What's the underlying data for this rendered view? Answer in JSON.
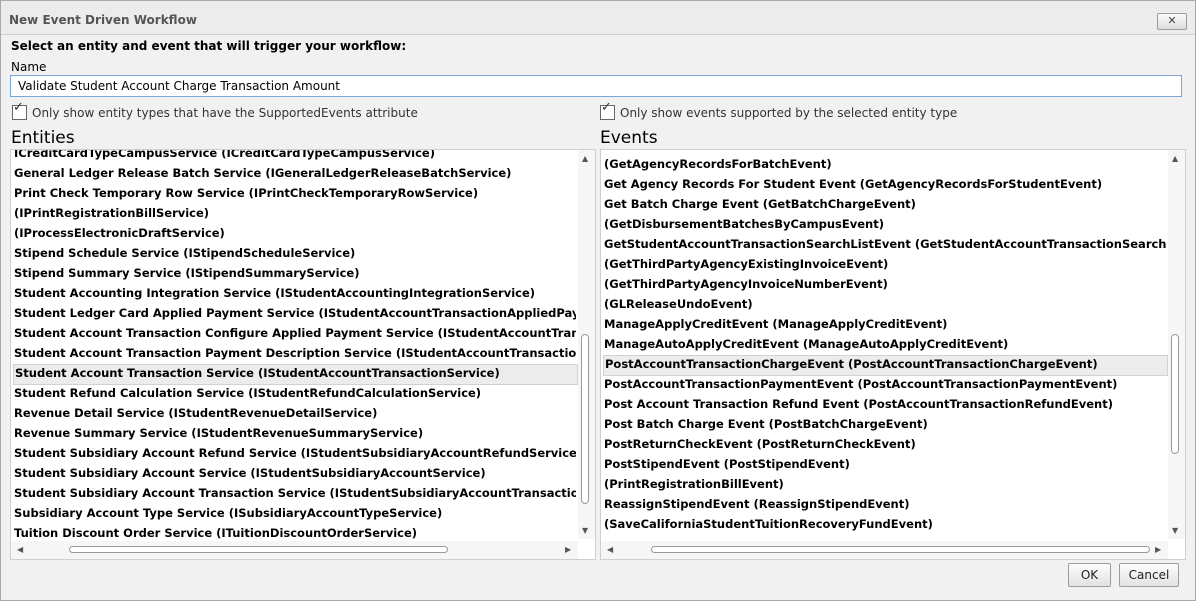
{
  "window": {
    "title": "New Event Driven Workflow",
    "close_glyph": "✕"
  },
  "instruction": "Select an entity and event that will trigger your workflow:",
  "name_field": {
    "label": "Name",
    "value": "Validate Student Account Charge Transaction Amount"
  },
  "entity_filter": {
    "label": "Only show entity types that have the SupportedEvents attribute",
    "checked": true
  },
  "event_filter": {
    "label": "Only show events supported by the selected entity type",
    "checked": true
  },
  "entities": {
    "title": "Entities",
    "selected_index": 11,
    "items": [
      "ICreditCardTypeCampusService (ICreditCardTypeCampusService)",
      "General Ledger Release Batch Service (IGeneralLedgerReleaseBatchService)",
      "Print Check Temporary Row Service (IPrintCheckTemporaryRowService)",
      " (IPrintRegistrationBillService)",
      " (IProcessElectronicDraftService)",
      "Stipend Schedule Service (IStipendScheduleService)",
      "Stipend Summary Service (IStipendSummaryService)",
      "Student Accounting Integration Service (IStudentAccountingIntegrationService)",
      "Student Ledger Card Applied Payment Service (IStudentAccountTransactionAppliedPaymentService)",
      "Student Account Transaction Configure Applied Payment Service (IStudentAccountTransactionConfi",
      "Student Account Transaction Payment Description Service (IStudentAccountTransactionPaymentDes",
      "Student Account Transaction Service (IStudentAccountTransactionService)",
      "Student Refund Calculation Service (IStudentRefundCalculationService)",
      "Revenue Detail Service (IStudentRevenueDetailService)",
      "Revenue Summary Service (IStudentRevenueSummaryService)",
      "Student Subsidiary Account Refund Service (IStudentSubsidiaryAccountRefundService)",
      "Student Subsidiary Account Service (IStudentSubsidiaryAccountService)",
      "Student Subsidiary Account Transaction Service (IStudentSubsidiaryAccountTransactionService)",
      "Subsidiary Account Type Service (ISubsidiaryAccountTypeService)",
      "Tuition Discount Order Service (ITuitionDiscountOrderService)"
    ]
  },
  "events": {
    "title": "Events",
    "selected_index": 10,
    "items": [
      " (GetAgencyRecordsForBatchEvent)",
      "Get Agency Records For Student Event (GetAgencyRecordsForStudentEvent)",
      "Get Batch Charge Event (GetBatchChargeEvent)",
      " (GetDisbursementBatchesByCampusEvent)",
      "GetStudentAccountTransactionSearchListEvent (GetStudentAccountTransactionSearchListEvent)",
      " (GetThirdPartyAgencyExistingInvoiceEvent)",
      " (GetThirdPartyAgencyInvoiceNumberEvent)",
      " (GLReleaseUndoEvent)",
      "ManageApplyCreditEvent (ManageApplyCreditEvent)",
      "ManageAutoApplyCreditEvent (ManageAutoApplyCreditEvent)",
      "PostAccountTransactionChargeEvent (PostAccountTransactionChargeEvent)",
      "PostAccountTransactionPaymentEvent (PostAccountTransactionPaymentEvent)",
      "Post Account Transaction Refund Event (PostAccountTransactionRefundEvent)",
      "Post Batch Charge Event (PostBatchChargeEvent)",
      "PostReturnCheckEvent (PostReturnCheckEvent)",
      "PostStipendEvent (PostStipendEvent)",
      " (PrintRegistrationBillEvent)",
      "ReassignStipendEvent (ReassignStipendEvent)",
      " (SaveCaliforniaStudentTuitionRecoveryFundEvent)"
    ]
  },
  "buttons": {
    "ok": "OK",
    "cancel": "Cancel"
  }
}
